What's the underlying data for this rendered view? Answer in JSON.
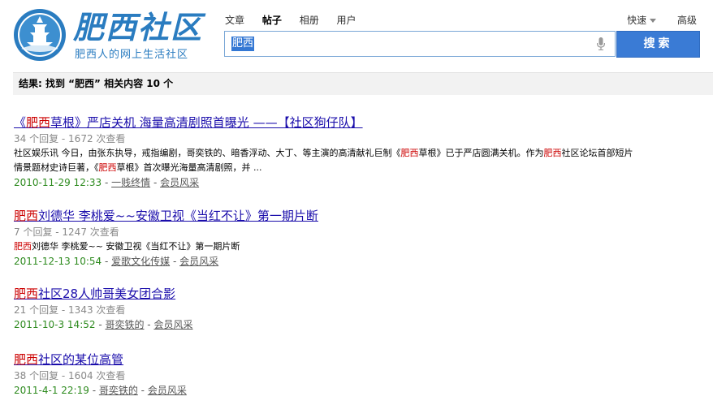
{
  "logo": {
    "title": "肥西社区",
    "subtitle": "肥西人的网上生活社区"
  },
  "nav": {
    "tabs": [
      "文章",
      "帖子",
      "相册",
      "用户"
    ],
    "active_tab": 1,
    "quick": "快速",
    "advanced": "高级"
  },
  "search": {
    "value": "肥西",
    "button": "搜索"
  },
  "result_summary": "结果: 找到 “肥西” 相关内容 10 个",
  "results": [
    {
      "title_pre": "《",
      "title_hl": "肥西",
      "title_post": "草根》严店关机 海量高清剧照首曝光 ——【社区狗仔队】",
      "meta": "34 个回复 - 1672 次查看",
      "snippet_parts": [
        {
          "t": "社区娱乐讯 今日，由张东执导，戒指编剧，哥奕铁的、暗香浮动、大丁、等主演的高清献礼巨制《",
          "h": false
        },
        {
          "t": "肥西",
          "h": true
        },
        {
          "t": "草根》已于严店圆满关机。作为",
          "h": false
        },
        {
          "t": "肥西",
          "h": true
        },
        {
          "t": "社区论坛首部短片情景题材史诗巨著，《",
          "h": false
        },
        {
          "t": "肥西",
          "h": true
        },
        {
          "t": "草根》首次曝光海量高清剧照，并 ...",
          "h": false
        }
      ],
      "date": "2010-11-29 12:33",
      "author": "一贱终情",
      "forum": "会员风采"
    },
    {
      "title_pre": "",
      "title_hl": "肥西",
      "title_post": "刘德华 李桃爱~~安徽卫视《当红不让》第一期片断",
      "meta": "7 个回复 - 1247 次查看",
      "snippet_parts": [
        {
          "t": "肥西",
          "h": true
        },
        {
          "t": "刘德华 李桃爱~~ 安徽卫视《当红不让》第一期片断",
          "h": false
        }
      ],
      "date": "2011-12-13 10:54",
      "author": "爱歌文化传媒",
      "forum": "会员风采"
    },
    {
      "title_pre": "",
      "title_hl": "肥西",
      "title_post": "社区28人帅哥美女团合影",
      "meta": "21 个回复 - 1343 次查看",
      "snippet_parts": [],
      "date": "2011-10-3 14:52",
      "author": "哥奕铁的",
      "forum": "会员风采"
    },
    {
      "title_pre": "",
      "title_hl": "肥西",
      "title_post": "社区的某位高管",
      "meta": "38 个回复 - 1604 次查看",
      "snippet_parts": [],
      "date": "2011-4-1 22:19",
      "author": "哥奕铁的",
      "forum": "会员风采"
    }
  ],
  "colors": {
    "brand": "#2a7cc0",
    "link": "#1a0dab",
    "highlight": "#cc0000",
    "date": "#2d8a1e",
    "button": "#3a7bd5"
  }
}
